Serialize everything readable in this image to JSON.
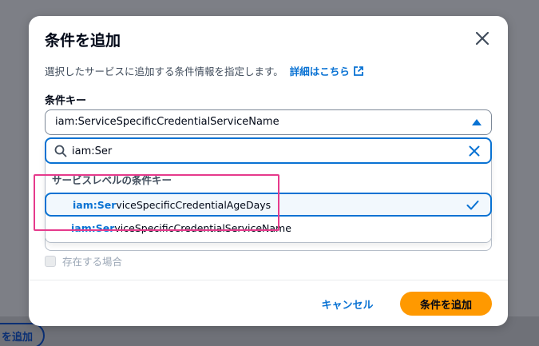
{
  "background": {
    "add_button_label": "を追加"
  },
  "modal": {
    "title": "条件を追加",
    "description": "選択したサービスに追加する条件情報を指定します。",
    "learn_more": "詳細はこちら",
    "field_label": "条件キー",
    "selected_value": "iam:ServiceSpecificCredentialServiceName",
    "search": {
      "value": "iam:Ser",
      "placeholder": ""
    },
    "dropdown": {
      "group_header": "サービスレベルの条件キー",
      "options": [
        {
          "match": "iam:Ser",
          "rest": "viceSpecificCredentialAgeDays",
          "selected": true
        },
        {
          "match": "iam:Ser",
          "rest": "viceSpecificCredentialServiceName",
          "selected": false
        }
      ]
    },
    "checkbox_label": "存在する場合",
    "cancel_label": "キャンセル",
    "submit_label": "条件を追加"
  },
  "colors": {
    "accent": "#0972d3",
    "primary_button": "#ff9900",
    "annotation_highlight": "#e63a8c"
  }
}
